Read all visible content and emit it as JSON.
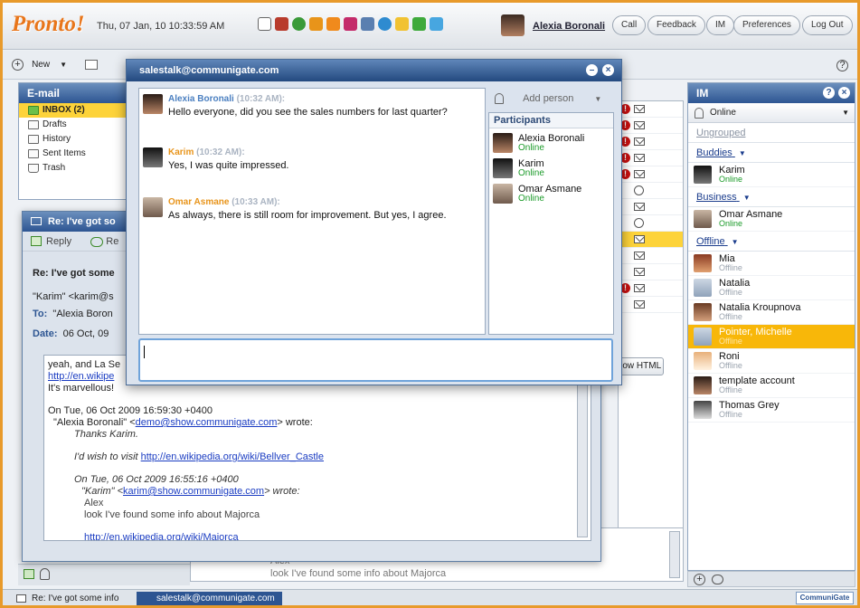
{
  "app": {
    "logo": "Pronto!",
    "datetime": "Thu, 07 Jan, 10 10:33:59 AM",
    "user_name": "Alexia Boronali"
  },
  "top_buttons": [
    "Call",
    "Feedback",
    "IM",
    "Preferences",
    "Log Out"
  ],
  "toolbar": {
    "new_label": "New",
    "help_icon": "?"
  },
  "email": {
    "title": "E-mail",
    "folders": [
      {
        "label": "INBOX (2)",
        "icon": "inbox-icon"
      },
      {
        "label": "Drafts",
        "icon": "drafts-icon"
      },
      {
        "label": "History",
        "icon": "history-icon"
      },
      {
        "label": "Sent Items",
        "icon": "sent-icon"
      },
      {
        "label": "Trash",
        "icon": "trash-icon"
      }
    ]
  },
  "message": {
    "window_title": "Re: I've got so",
    "reply_label": "Reply",
    "reply_all_label": "Re",
    "subject": "Re: I've got some",
    "from": "\"Karim\" <karim@s",
    "to_label": "To:",
    "to_value": "\"Alexia Boron",
    "date_label": "Date:",
    "date_value": "06 Oct, 09",
    "show_html": "how HTML",
    "body": {
      "l1": "yeah, and La Se",
      "l2": "http://en.wikipe",
      "l3": "It's marvellous!",
      "l4": "On Tue, 06 Oct 2009 16:59:30 +0400",
      "l5a": "\"Alexia Boronali\" <",
      "l5link": "demo@show.communigate.com",
      "l5b": "> wrote:",
      "l6": "Thanks Karim.",
      "l7a": "I'd wish to visit ",
      "l7link": "http://en.wikipedia.org/wiki/Bellver_Castle",
      "l8": "On Tue, 06 Oct 2009 16:55:16 +0400",
      "l9a": "\"Karim\" <",
      "l9link": "karim@show.communigate.com",
      "l9b": "> wrote:",
      "l10": "Alex",
      "l11": "look I've found some info about Majorca",
      "l12": "http://en.wikipedia.org/wiki/Majorca"
    },
    "lower_preview": [
      "Alex",
      "look I've found some info about Majorca"
    ]
  },
  "chat": {
    "title": "salestalk@communigate.com",
    "add_person": "Add person",
    "participants_header": "Participants",
    "messages": [
      {
        "name": "Alexia Boronali",
        "time": "(10:32 AM):",
        "text": "Hello everyone, did you see the sales numbers for last quarter?",
        "color": "#4a7fc0"
      },
      {
        "name": "Karim",
        "time": "(10:32 AM):",
        "text": "Yes, I was quite impressed.",
        "color": "#e8941a"
      },
      {
        "name": "Omar Asmane",
        "time": "(10:33 AM):",
        "text": "As always, there is still room for improvement. But yes, I agree.",
        "color": "#e8941a"
      }
    ],
    "participants": [
      {
        "name": "Alexia Boronali",
        "status": "Online"
      },
      {
        "name": "Karim",
        "status": "Online"
      },
      {
        "name": "Omar Asmane",
        "status": "Online"
      }
    ]
  },
  "im": {
    "title": "IM",
    "status": "Online",
    "ungrouped": "Ungrouped",
    "groups": [
      {
        "name": "Buddies",
        "contacts": [
          {
            "name": "Karim",
            "status": "Online"
          }
        ]
      },
      {
        "name": "Business",
        "contacts": [
          {
            "name": "Omar Asmane",
            "status": "Online"
          }
        ]
      },
      {
        "name": "Offline",
        "contacts": [
          {
            "name": "Mia",
            "status": "Offline"
          },
          {
            "name": "Natalia",
            "status": "Offline"
          },
          {
            "name": "Natalia Kroupnova",
            "status": "Offline"
          },
          {
            "name": "Pointer, Michelle",
            "status": "Offline"
          },
          {
            "name": "Roni",
            "status": "Offline"
          },
          {
            "name": "template account",
            "status": "Offline"
          },
          {
            "name": "Thomas Grey",
            "status": "Offline"
          }
        ]
      }
    ]
  },
  "taskbar": {
    "items": [
      "Re: I've got some info",
      "salestalk@communigate.com"
    ],
    "brand": "CommuniGate Pro"
  },
  "colors": {
    "accent": "#2d5592",
    "highlight": "#fdd33a",
    "online": "#1c9b2a",
    "alert": "#c81010"
  }
}
